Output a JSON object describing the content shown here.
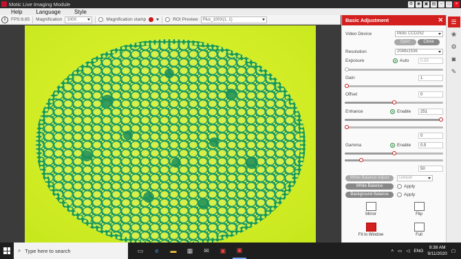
{
  "window": {
    "title": "Motic Live Imaging Module",
    "controls": [
      "settings",
      "camera",
      "photo",
      "capture",
      "minimize",
      "maximize",
      "close"
    ]
  },
  "menu": [
    "Help",
    "Language",
    "Style"
  ],
  "toolbar": {
    "fps": "FPS:8.85",
    "magnification_label": "Magnification",
    "magnification_value": "100X",
    "stamp_label": "Magnification stamp",
    "roi_label": "ROI Preview",
    "calibration_value": "Plus_100X(1, 1)"
  },
  "panel": {
    "title": "Basic Adjustment",
    "video_device_label": "Video Device",
    "video_device_value": "Motic CCD252",
    "open_label": "Open",
    "close_label": "Close",
    "resolution_label": "Resolution",
    "resolution_value": "2048x1536",
    "exposure_label": "Exposure",
    "auto_label": "Auto",
    "exposure_value": "0.59",
    "gain_label": "Gain",
    "gain_value": "1",
    "offset_label": "Offset",
    "offset_value": "0",
    "enhance_label": "Enhance",
    "enhance_enable": "Enable",
    "enhance_value": "251",
    "enhance_extra_value": "0",
    "gamma_label": "Gamma",
    "gamma_enable": "Enable",
    "gamma_value": "0.5",
    "gamma_extra_value": "50",
    "white_balance_adjust": "White Balance Adjust",
    "wb_default": "Default",
    "white_balance": "White Balance",
    "apply": "Apply",
    "background_balance": "Background Balance",
    "apply2": "Apply",
    "mirror": "Mirror",
    "flip": "Flip",
    "fit_to_window": "Fit to Window",
    "full": "Full",
    "sliders": {
      "exposure": 0.0,
      "gain": 0.0,
      "offset": 0.5,
      "enhance": 0.98,
      "enhance_extra": 0.0,
      "gamma": 0.5,
      "gamma_extra": 0.17
    }
  },
  "taskbar": {
    "search_placeholder": "Type here to search",
    "language": "ENG",
    "time": "9:38 AM",
    "date": "9/11/2020"
  },
  "colors": {
    "accent": "#d41f1f",
    "specimen_bg": "#d9f22a",
    "cell_green": "#25a86b"
  }
}
